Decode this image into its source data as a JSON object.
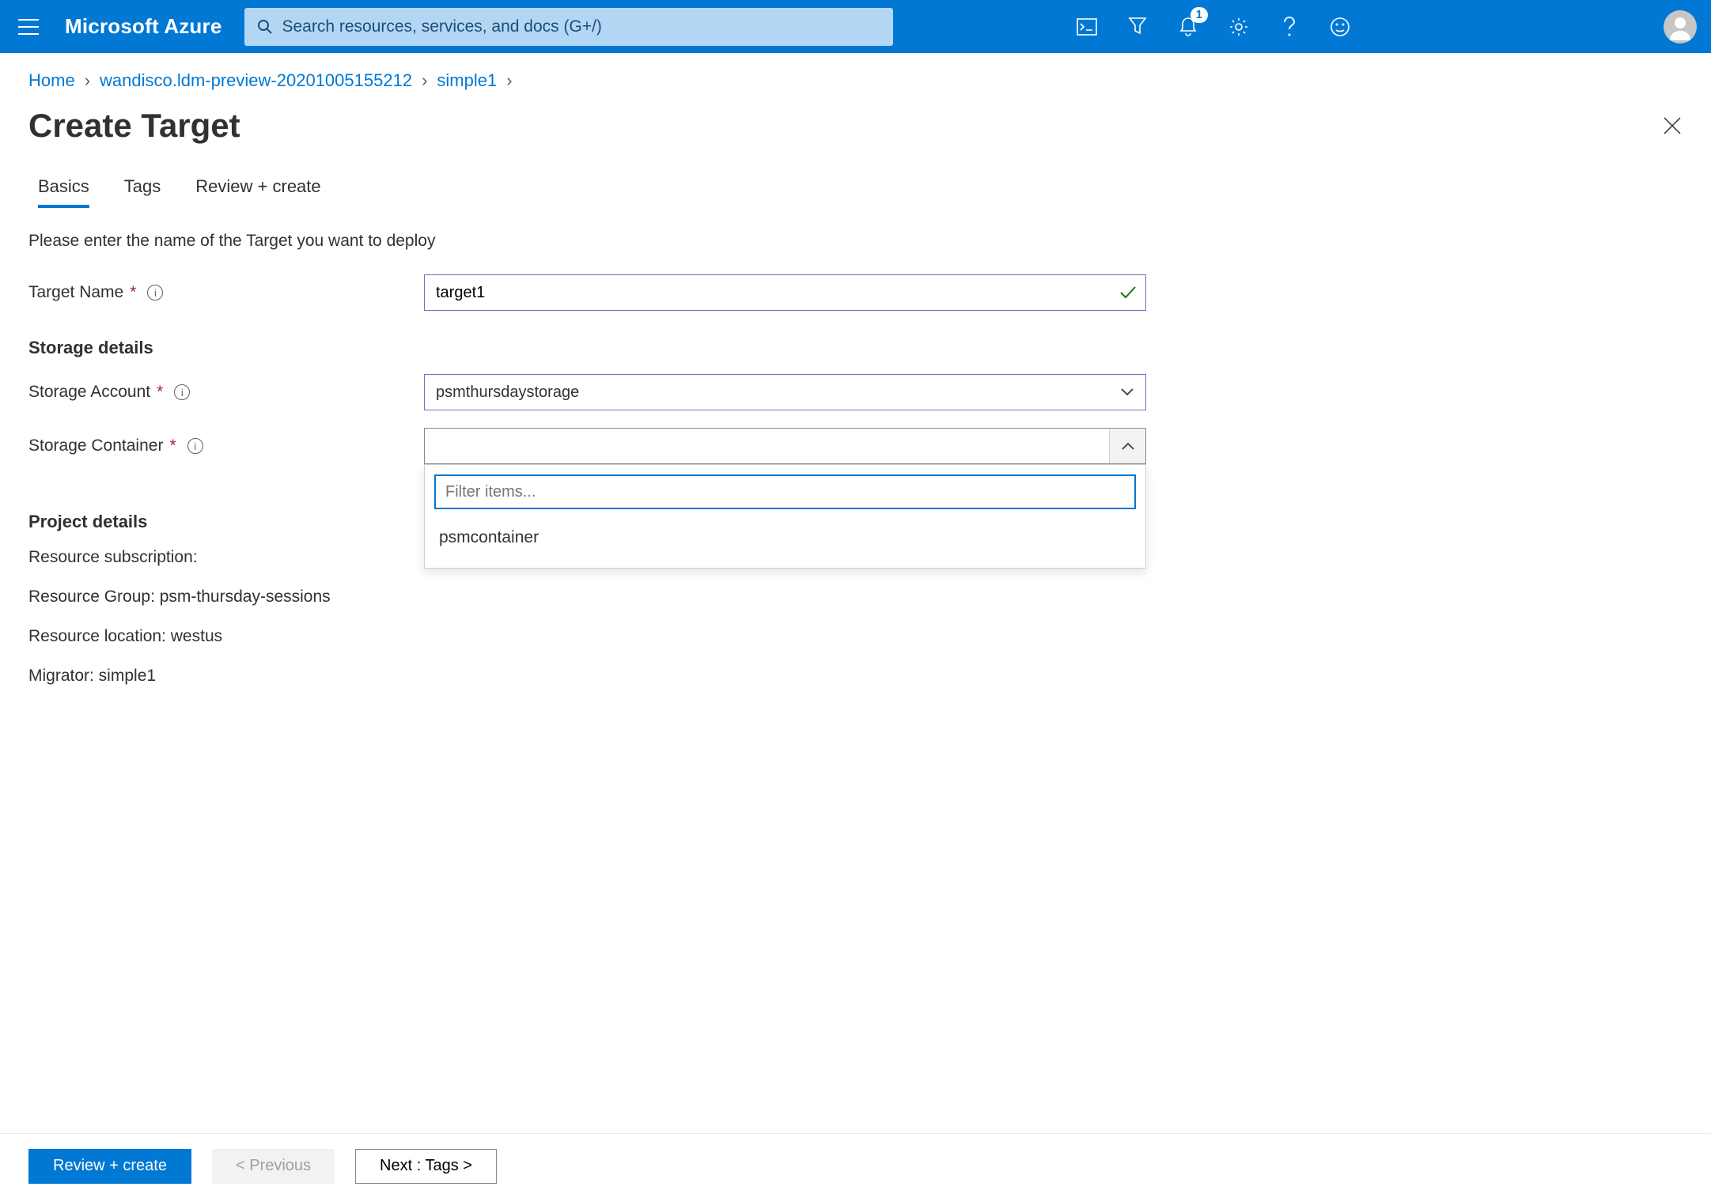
{
  "colors": {
    "accent": "#0078d4",
    "danger": "#a4262c",
    "success": "#107c10"
  },
  "header": {
    "brand": "Microsoft Azure",
    "search_placeholder": "Search resources, services, and docs (G+/)",
    "notification_count": "1"
  },
  "breadcrumb": {
    "items": [
      "Home",
      "wandisco.ldm-preview-20201005155212",
      "simple1"
    ]
  },
  "page": {
    "title": "Create Target"
  },
  "tabs": {
    "items": [
      {
        "label": "Basics",
        "active": true
      },
      {
        "label": "Tags",
        "active": false
      },
      {
        "label": "Review + create",
        "active": false
      }
    ]
  },
  "form": {
    "instruction": "Please enter the name of the Target you want to deploy",
    "target_name": {
      "label": "Target Name",
      "value": "target1"
    },
    "storage_section": "Storage details",
    "storage_account": {
      "label": "Storage Account",
      "value": "psmthursdaystorage"
    },
    "storage_container": {
      "label": "Storage Container",
      "value": "",
      "filter_placeholder": "Filter items...",
      "options": [
        "psmcontainer"
      ]
    },
    "project_section": "Project details",
    "subscription": {
      "label": "Resource subscription:",
      "value": ""
    },
    "resource_group": {
      "line": "Resource Group: psm-thursday-sessions"
    },
    "resource_location": {
      "line": "Resource location: westus"
    },
    "migrator": {
      "line": "Migrator: simple1"
    }
  },
  "footer": {
    "review": "Review + create",
    "previous": "< Previous",
    "next": "Next : Tags >"
  }
}
